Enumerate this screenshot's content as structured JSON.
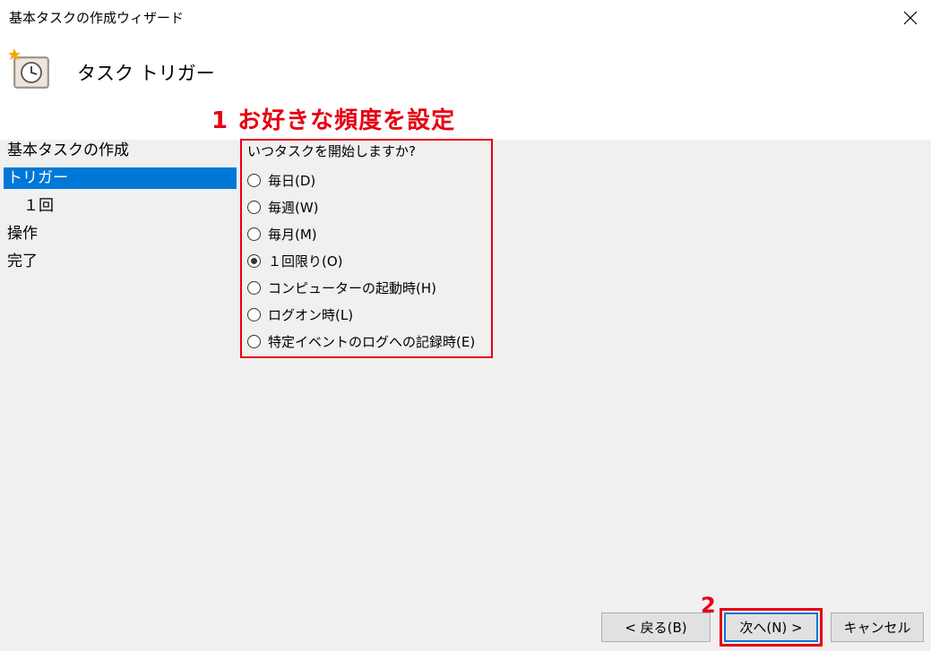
{
  "window": {
    "title": "基本タスクの作成ウィザード"
  },
  "header": {
    "title": "タスク トリガー",
    "icon": "task-scheduler-clock-icon"
  },
  "annotations": {
    "step1": "1 お好きな頻度を設定",
    "step2": "2",
    "color": "#e60012"
  },
  "sidebar": {
    "items": [
      {
        "label": "基本タスクの作成",
        "selected": false
      },
      {
        "label": "トリガー",
        "selected": true
      },
      {
        "label": "１回",
        "selected": false
      },
      {
        "label": "操作",
        "selected": false
      },
      {
        "label": "完了",
        "selected": false
      }
    ]
  },
  "trigger": {
    "question": "いつタスクを開始しますか?",
    "options": [
      {
        "label": "毎日(D)",
        "checked": false
      },
      {
        "label": "毎週(W)",
        "checked": false
      },
      {
        "label": "毎月(M)",
        "checked": false
      },
      {
        "label": "１回限り(O)",
        "checked": true
      },
      {
        "label": "コンピューターの起動時(H)",
        "checked": false
      },
      {
        "label": "ログオン時(L)",
        "checked": false
      },
      {
        "label": "特定イベントのログへの記録時(E)",
        "checked": false
      }
    ]
  },
  "buttons": {
    "back": "< 戻る(B)",
    "next": "次へ(N) >",
    "cancel": "キャンセル"
  },
  "colors": {
    "selection": "#0078d7",
    "accent": "#e60012"
  }
}
